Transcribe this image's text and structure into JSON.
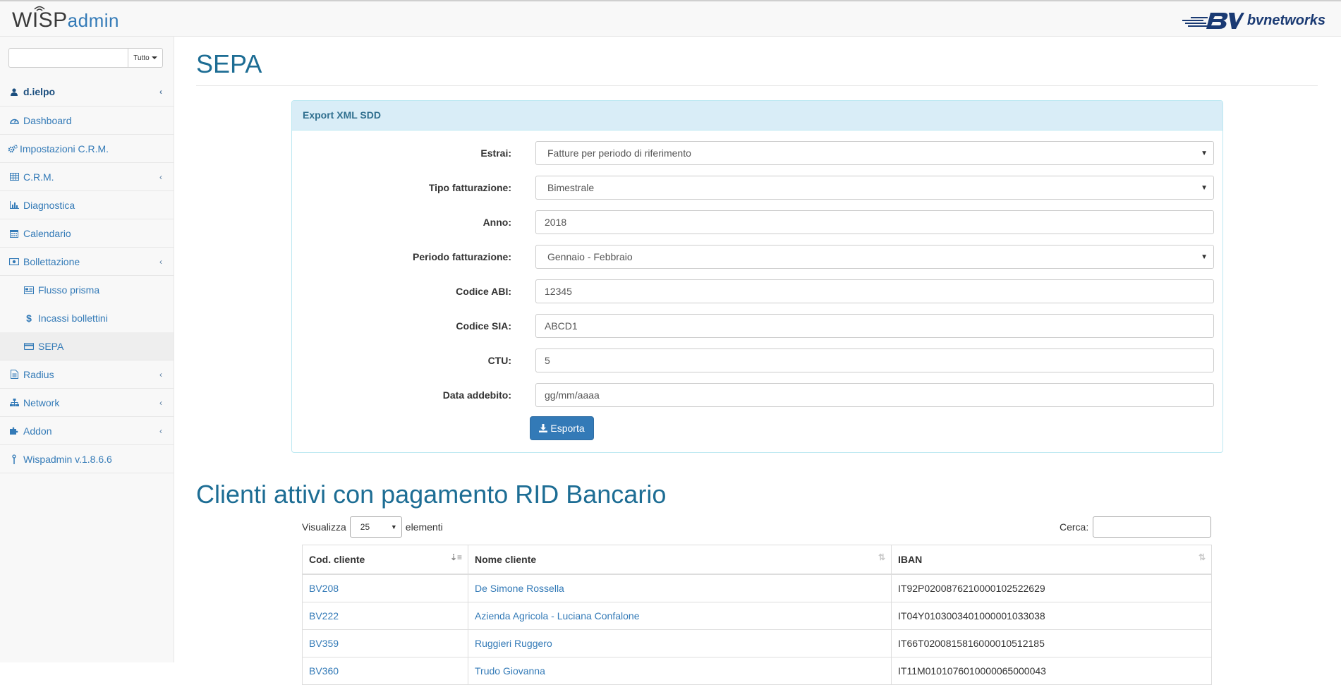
{
  "brand": {
    "app_left_prefix": "WISP",
    "app_left_suffix": "admin",
    "partner": "bvnetworks",
    "accent": "#337ab7"
  },
  "sidebar": {
    "search_value": "",
    "search_dropdown": "Tutto",
    "user": "d.ielpo",
    "items": [
      {
        "label": "Dashboard",
        "icon": "dashboard-icon"
      },
      {
        "label": "Impostazioni C.R.M.",
        "icon": "cogs-icon"
      },
      {
        "label": "C.R.M.",
        "icon": "table-icon"
      },
      {
        "label": "Diagnostica",
        "icon": "bar-chart-icon"
      },
      {
        "label": "Calendario",
        "icon": "calendar-icon"
      },
      {
        "label": "Bollettazione",
        "icon": "money-icon"
      },
      {
        "label": "Flusso prisma",
        "icon": "newspaper-icon"
      },
      {
        "label": "Incassi bollettini",
        "icon": "dollar-icon"
      },
      {
        "label": "SEPA",
        "icon": "credit-card-icon"
      },
      {
        "label": "Radius",
        "icon": "file-icon"
      },
      {
        "label": "Network",
        "icon": "sitemap-icon"
      },
      {
        "label": "Addon",
        "icon": "puzzle-icon"
      },
      {
        "label": "Wispadmin v.1.8.6.6",
        "icon": "antenna-icon"
      }
    ]
  },
  "main": {
    "title": "SEPA",
    "panel": {
      "heading": "Export XML SDD",
      "fields": [
        {
          "label": "Estrai:",
          "value": "Fatture per periodo di riferimento",
          "type": "select"
        },
        {
          "label": "Tipo fatturazione:",
          "value": "Bimestrale",
          "type": "select"
        },
        {
          "label": "Anno:",
          "value": "2018",
          "type": "input"
        },
        {
          "label": "Periodo fatturazione:",
          "value": "Gennaio - Febbraio",
          "type": "select"
        },
        {
          "label": "Codice ABI:",
          "value": "12345",
          "type": "input"
        },
        {
          "label": "Codice SIA:",
          "value": "ABCD1",
          "type": "input"
        },
        {
          "label": "CTU:",
          "value": "5",
          "type": "input"
        },
        {
          "label": "Data addebito:",
          "value": "",
          "placeholder": "gg/mm/aaaa",
          "type": "input"
        }
      ],
      "export_button": "Esporta"
    },
    "section_title": "Clienti attivi con pagamento RID Bancario",
    "table_controls": {
      "show_prefix": "Visualizza",
      "page_size": "25",
      "show_suffix": "elementi",
      "search_label": "Cerca:",
      "search_value": ""
    },
    "table": {
      "columns": [
        "Cod. cliente",
        "Nome cliente",
        "IBAN"
      ],
      "rows": [
        [
          "BV208",
          "De Simone Rossella",
          "IT92P0200876210000102522629"
        ],
        [
          "BV222",
          "Azienda Agricola - Luciana Confalone",
          "IT04Y0103003401000001033038"
        ],
        [
          "BV359",
          "Ruggieri Ruggero",
          "IT66T0200815816000010512185"
        ],
        [
          "BV360",
          "Trudo Giovanna",
          "IT11M0101076010000065000043"
        ]
      ]
    }
  }
}
